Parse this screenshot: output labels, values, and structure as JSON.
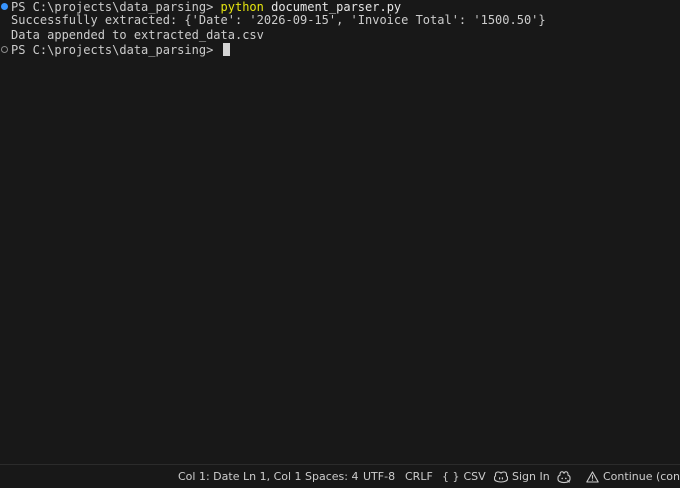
{
  "terminal": {
    "lines": [
      {
        "prompt": "PS C:\\projects\\data_parsing> ",
        "command": "python",
        "args": " document_parser.py",
        "decoration": "success"
      },
      {
        "output": "Successfully extracted: {'Date': '2026-09-15', 'Invoice Total': '1500.50'}"
      },
      {
        "output": "Data appended to extracted_data.csv"
      },
      {
        "prompt": "PS C:\\projects\\data_parsing> ",
        "decoration": "pending"
      }
    ]
  },
  "statusbar": {
    "col_mode": "Col 1: Date",
    "position": "Ln 1, Col 1",
    "spaces": "Spaces: 4",
    "encoding": "UTF-8",
    "eol": "CRLF",
    "language_icon": "{ }",
    "language": "CSV",
    "signin": "Sign In",
    "continue": "Continue (config"
  },
  "colors": {
    "background": "#181818",
    "text": "#cccccc",
    "command": "#e5e510",
    "decoration_success": "#3794ff",
    "decoration_pending": "#8b8b8b"
  },
  "icons": {
    "line_0_decoration": "command-success-dot-icon",
    "line_3_decoration": "command-pending-ring-icon",
    "signin": "copilot-icon",
    "copilot": "copilot-status-icon",
    "continue": "warning-icon"
  }
}
